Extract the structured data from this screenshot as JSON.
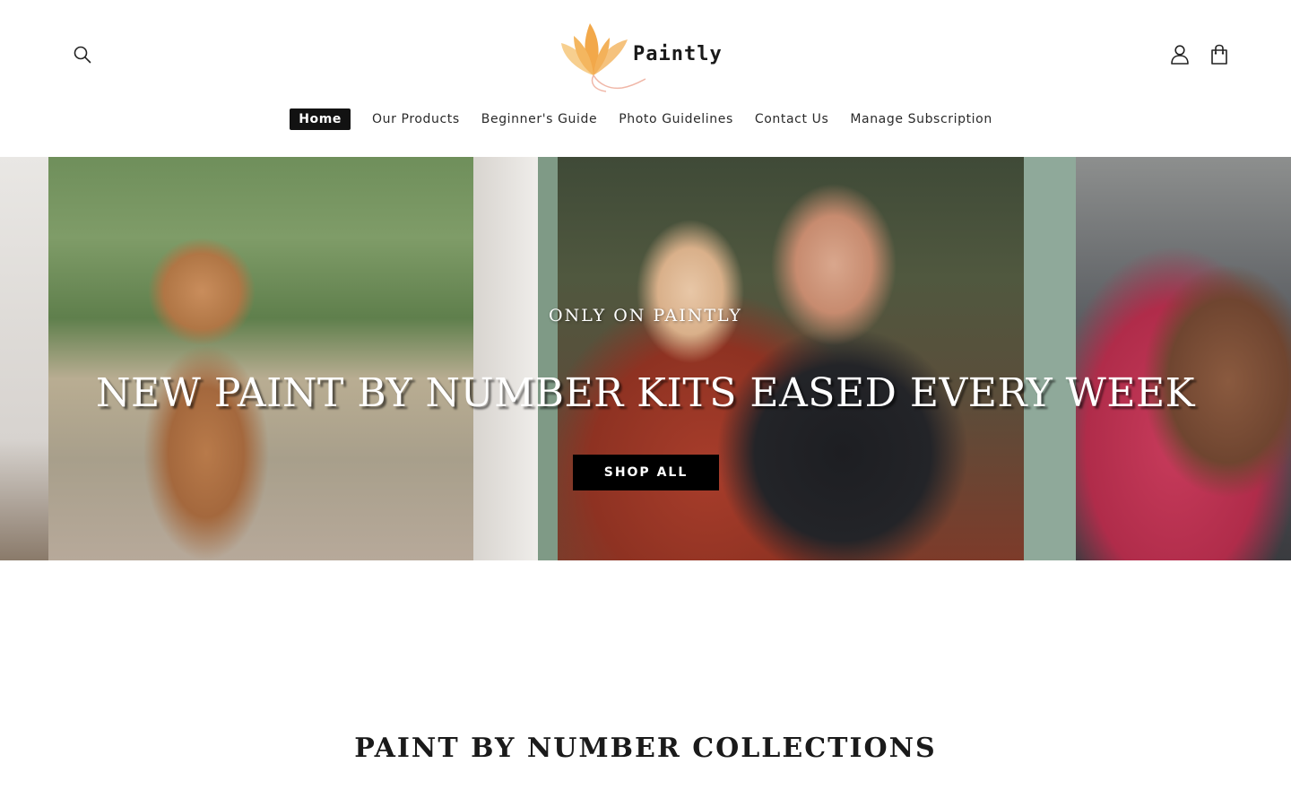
{
  "brand": {
    "name": "Paintly",
    "logo_icon": "lotus-icon",
    "accent_colors": [
      "#f2a84a",
      "#f7cf8f",
      "#f0b7a8"
    ]
  },
  "header": {
    "search_icon": "search-icon",
    "account_icon": "account-icon",
    "cart_icon": "shopping-bag-icon"
  },
  "nav": {
    "items": [
      {
        "label": "Home",
        "active": true
      },
      {
        "label": "Our Products",
        "active": false
      },
      {
        "label": "Beginner's Guide",
        "active": false
      },
      {
        "label": "Photo Guidelines",
        "active": false
      },
      {
        "label": "Contact Us",
        "active": false
      },
      {
        "label": "Manage Subscription",
        "active": false
      }
    ]
  },
  "hero": {
    "eyebrow": "ONLY ON PAINTLY",
    "heading": "NEW PAINT BY NUMBER KITS EASED EVERY WEEK",
    "button_label": "SHOP ALL"
  },
  "collections": {
    "title": "PAINT BY NUMBER COLLECTIONS"
  }
}
